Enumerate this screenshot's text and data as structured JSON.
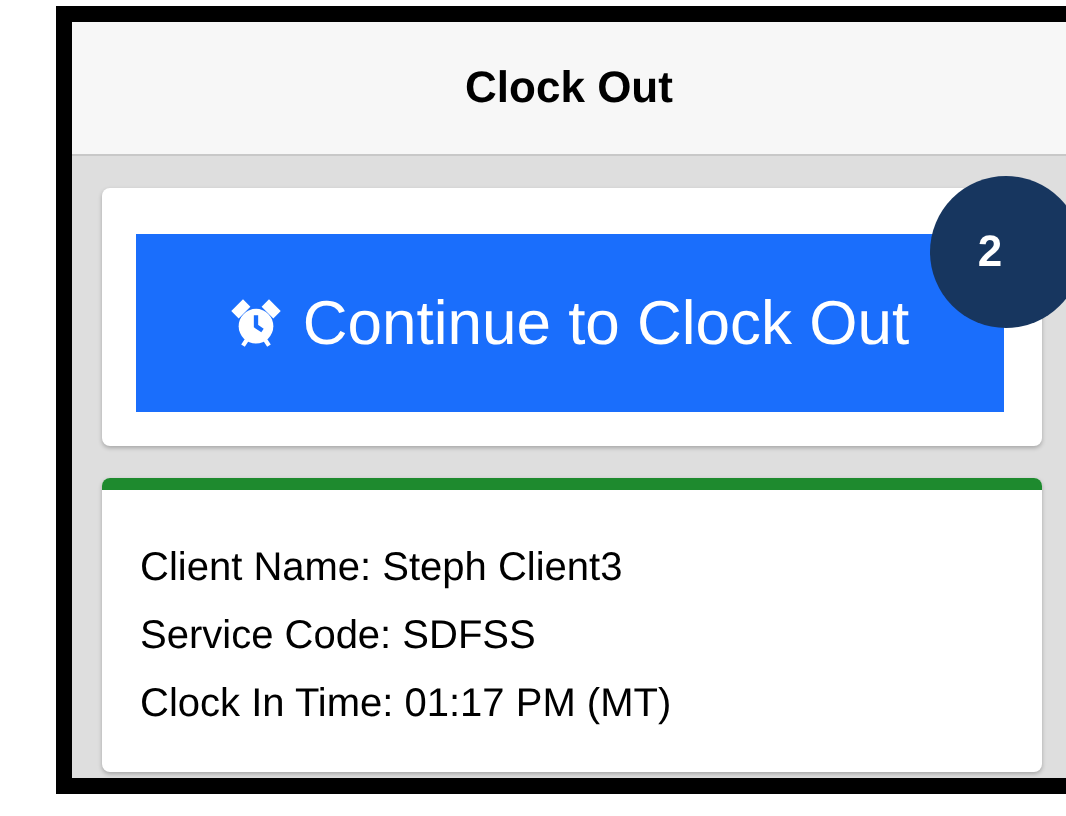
{
  "header": {
    "title": "Clock Out"
  },
  "action": {
    "label": "Continue to Clock Out",
    "badge": "2"
  },
  "visit": {
    "active": true,
    "lines": [
      "Client Name: Steph Client3",
      "Service Code: SDFSS",
      "Clock In Time: 01:17 PM (MT)"
    ]
  }
}
